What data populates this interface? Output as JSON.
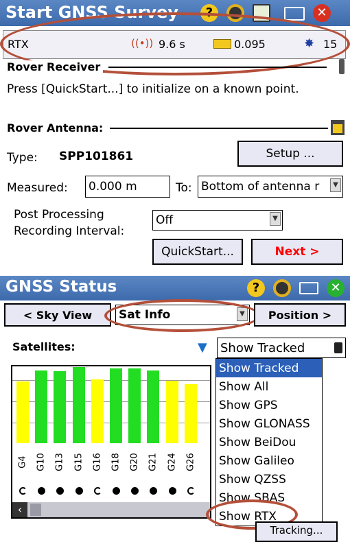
{
  "survey": {
    "title": "Start GNSS Survey",
    "status": {
      "mode": "RTX",
      "age": "9.6 s",
      "precision": "0.095",
      "satellites": "15"
    },
    "rover_receiver_label": "Rover Receiver",
    "instruction": "Press [QuickStart...] to initialize on a known point.",
    "rover_antenna_label": "Rover Antenna:",
    "type_label": "Type:",
    "type_value": "SPP101861",
    "setup_button": "Setup ...",
    "measured_label": "Measured:",
    "measured_value": "0.000 m",
    "to_label": "To:",
    "to_value": "Bottom of antenna r",
    "pp_label_1": "Post Processing",
    "pp_label_2": "Recording Interval:",
    "pp_value": "Off",
    "quickstart_button": "QuickStart...",
    "next_button": "Next >"
  },
  "status": {
    "title": "GNSS Status",
    "sky_view_button": "< Sky View",
    "view_select": "Sat Info",
    "position_button": "Position >",
    "satellites_label": "Satellites:",
    "filter_select": "Show Tracked",
    "filter_options": [
      "Show Tracked",
      "Show All",
      "Show GPS",
      "Show GLONASS",
      "Show BeiDou",
      "Show Galileo",
      "Show QZSS",
      "Show SBAS",
      "Show RTX"
    ],
    "tracking_partial": "Tracking..."
  },
  "chart_data": {
    "type": "bar",
    "categories": [
      "G4",
      "G10",
      "G13",
      "G15",
      "G16",
      "G18",
      "G20",
      "G21",
      "G24",
      "G26"
    ],
    "values": [
      0.8,
      0.95,
      0.94,
      0.99,
      0.83,
      0.97,
      0.97,
      0.95,
      0.81,
      0.77
    ],
    "colors": [
      "#ffff00",
      "#22dd22",
      "#22dd22",
      "#22dd22",
      "#ffff00",
      "#22dd22",
      "#22dd22",
      "#22dd22",
      "#ffff00",
      "#ffff00"
    ],
    "status": [
      "partial",
      "full",
      "full",
      "full",
      "partial",
      "full",
      "full",
      "full",
      "full",
      "partial"
    ]
  },
  "colors": {
    "titlebar": "#3d6aab",
    "highlight": "#b4503a",
    "selected": "#2b5fb8",
    "next_text": "#ff0000"
  }
}
